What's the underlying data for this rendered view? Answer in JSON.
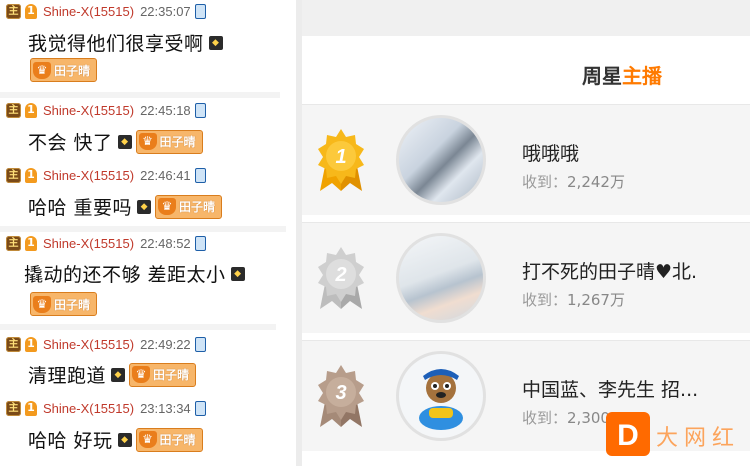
{
  "chat": {
    "messages": [
      {
        "user": "Shine-X(15515)",
        "time": "22:35:07",
        "text": "我觉得他们很享受啊",
        "tag": "田子晴"
      },
      {
        "user": "Shine-X(15515)",
        "time": "22:45:18",
        "text": "不会 快了",
        "tag": "田子晴"
      },
      {
        "user": "Shine-X(15515)",
        "time": "22:46:41",
        "text": "哈哈 重要吗",
        "tag": "田子晴"
      },
      {
        "user": "Shine-X(15515)",
        "time": "22:48:52",
        "text": "撬动的还不够 差距太小",
        "tag": "田子晴"
      },
      {
        "user": "Shine-X(15515)",
        "time": "22:49:22",
        "text": "清理跑道",
        "tag": "田子晴"
      },
      {
        "user": "Shine-X(15515)",
        "time": "23:13:34",
        "text": "哈哈 好玩",
        "tag": "田子晴"
      }
    ],
    "badge_zhu": "主",
    "badge_fan": "1"
  },
  "ranking": {
    "title_plain": "周星",
    "title_highlight": "主播",
    "received_label": "收到：",
    "entries": [
      {
        "rank": "1",
        "name": "哦哦哦",
        "amount": "2,242万",
        "medal_color": "#f5b10a"
      },
      {
        "rank": "2",
        "name": "打不死的田子晴♥北.",
        "amount": "1,267万",
        "medal_color": "#c9c9c9"
      },
      {
        "rank": "3",
        "name": "中国蓝、李先生 招...",
        "amount": "2,300,702",
        "medal_color": "#b09585"
      }
    ]
  },
  "watermark": {
    "logo_letter": "D",
    "text": "大网红"
  },
  "colors": {
    "username": "#c0392b",
    "accent": "#ff7a00"
  }
}
